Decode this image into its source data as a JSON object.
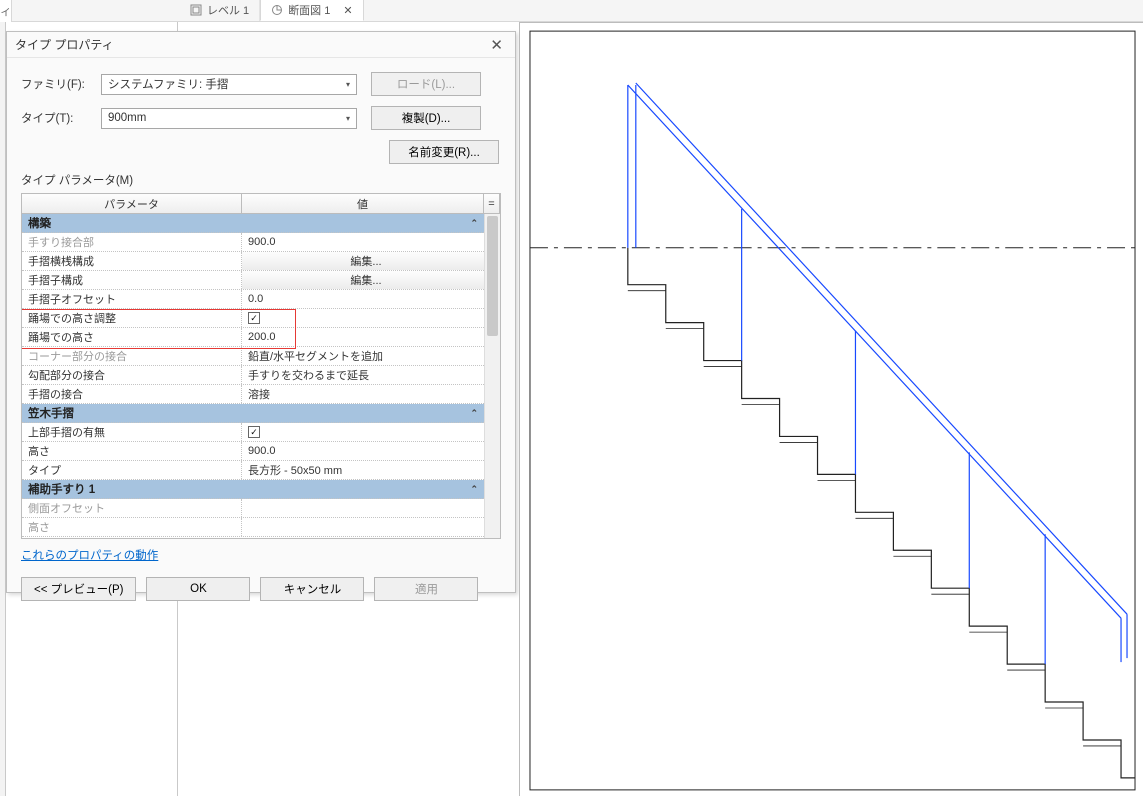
{
  "tabs": {
    "edge": "イ",
    "t1": {
      "label": "レベル 1"
    },
    "t2": {
      "label": "断面図 1"
    }
  },
  "dialog": {
    "title": "タイプ プロパティ",
    "family_label": "ファミリ(F):",
    "family_value": "システムファミリ: 手摺",
    "type_label": "タイプ(T):",
    "type_value": "900mm",
    "btn_load": "ロード(L)...",
    "btn_duplicate": "複製(D)...",
    "btn_rename": "名前変更(R)...",
    "section_label": "タイプ パラメータ(M)",
    "header_param": "パラメータ",
    "header_value": "値",
    "eq": "=",
    "link": "これらのプロパティの動作",
    "btn_preview": "<<  プレビュー(P)",
    "btn_ok": "OK",
    "btn_cancel": "キャンセル",
    "btn_apply": "適用"
  },
  "groups": {
    "g1": "構築",
    "g2": "笠木手摺",
    "g3": "補助手すり 1"
  },
  "params": {
    "r1n": "手すり接合部",
    "r1v": "900.0",
    "r2n": "手摺横桟構成",
    "r2v": "編集...",
    "r3n": "手摺子構成",
    "r3v": "編集...",
    "r4n": "手摺子オフセット",
    "r4v": "0.0",
    "r5n": "踊場での高さ調整",
    "r5v_checked": "✓",
    "r6n": "踊場での高さ",
    "r6v": "200.0",
    "r7n": "コーナー部分の接合",
    "r7v": "鉛直/水平セグメントを追加",
    "r8n": "勾配部分の接合",
    "r8v": "手すりを交わるまで延長",
    "r9n": "手摺の接合",
    "r9v": "溶接",
    "r10n": "上部手摺の有無",
    "r10v_checked": "✓",
    "r11n": "高さ",
    "r11v": "900.0",
    "r12n": "タイプ",
    "r12v": "長方形 - 50x50 mm",
    "r13n": "側面オフセット",
    "r13v": "",
    "r14n": "高さ",
    "r14v": ""
  },
  "chart_data": null
}
